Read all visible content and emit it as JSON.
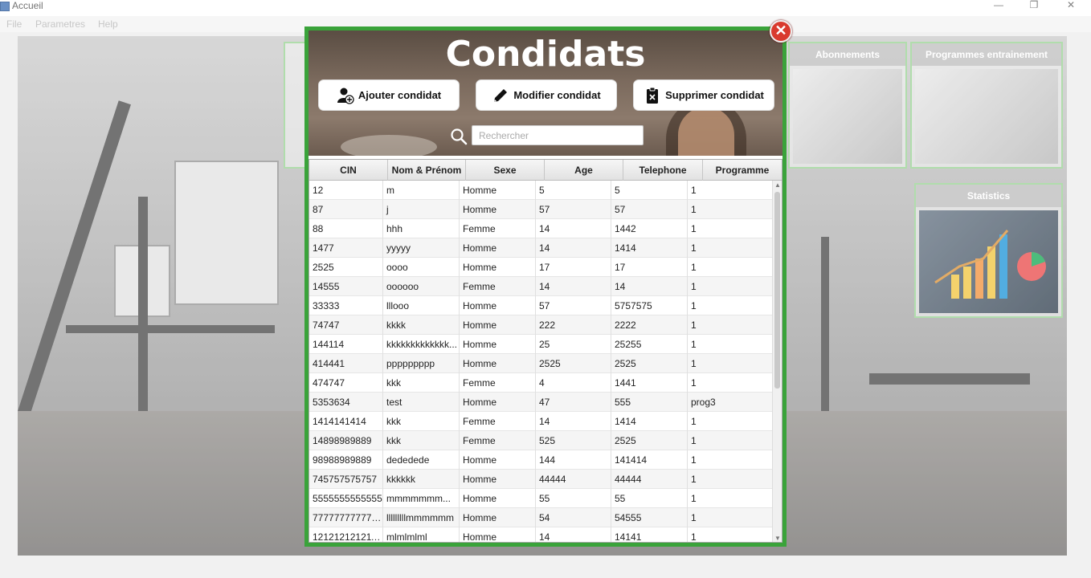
{
  "window": {
    "title": "Accueil",
    "minimize_glyph": "—",
    "restore_glyph": "❐",
    "close_glyph": "✕"
  },
  "menu": [
    "File",
    "Parametres",
    "Help"
  ],
  "background_cards": {
    "abonnements": "Abonnements",
    "programmes": "Programmes entrainement",
    "statistics": "Statistics"
  },
  "modal": {
    "title": "Condidats",
    "close_glyph": "✕",
    "buttons": {
      "add": "Ajouter condidat",
      "edit": "Modifier condidat",
      "delete": "Supprimer condidat"
    },
    "search": {
      "placeholder": "Rechercher",
      "value": ""
    },
    "accent_color": "#3aa33a",
    "close_color": "#d93a2e"
  },
  "table": {
    "columns": [
      "CIN",
      "Nom & Prénom",
      "Sexe",
      "Age",
      "Telephone",
      "Programme"
    ],
    "rows": [
      [
        "12",
        "m",
        "Homme",
        "5",
        "5",
        "1"
      ],
      [
        "87",
        "j",
        "Homme",
        "57",
        "57",
        "1"
      ],
      [
        "88",
        "hhh",
        "Femme",
        "14",
        "1442",
        "1"
      ],
      [
        "1477",
        "yyyyy",
        "Homme",
        "14",
        "1414",
        "1"
      ],
      [
        "2525",
        "oooo",
        "Homme",
        "17",
        "17",
        "1"
      ],
      [
        "14555",
        "oooooo",
        "Femme",
        "14",
        "14",
        "1"
      ],
      [
        "33333",
        "lllooo",
        "Homme",
        "57",
        "5757575",
        "1"
      ],
      [
        "74747",
        "kkkk",
        "Homme",
        "222",
        "2222",
        "1"
      ],
      [
        "144114",
        "kkkkkkkkkkkkk...",
        "Homme",
        "25",
        "25255",
        "1"
      ],
      [
        "414441",
        "ppppppppp",
        "Homme",
        "2525",
        "2525",
        "1"
      ],
      [
        "474747",
        "kkk",
        "Femme",
        "4",
        "1441",
        "1"
      ],
      [
        "5353634",
        "test",
        "Homme",
        "47",
        "555",
        "prog3"
      ],
      [
        "1414141414",
        "kkk",
        "Femme",
        "14",
        "1414",
        "1"
      ],
      [
        "14898989889",
        "kkk",
        "Femme",
        "525",
        "2525",
        "1"
      ],
      [
        "98988989889",
        "dededede",
        "Homme",
        "144",
        "141414",
        "1"
      ],
      [
        "745757575757",
        "kkkkkk",
        "Homme",
        "44444",
        "44444",
        "1"
      ],
      [
        "5555555555555",
        "mmmmmmm...",
        "Homme",
        "55",
        "55",
        "1"
      ],
      [
        "777777777777...",
        "lllllllllmmmmmm",
        "Homme",
        "54",
        "54555",
        "1"
      ],
      [
        "121212121211...",
        "mlmlmlml",
        "Homme",
        "14",
        "14141",
        "1"
      ]
    ]
  }
}
